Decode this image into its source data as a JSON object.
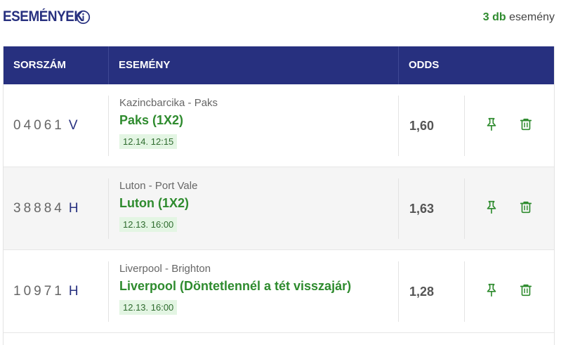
{
  "header": {
    "title": "ESEMÉNYEK",
    "count_number": "3 db",
    "count_label": "esemény"
  },
  "table": {
    "columns": [
      "SORSZÁM",
      "ESEMÉNY",
      "ODDS"
    ],
    "rows": [
      {
        "serial": "04061",
        "suffix": "V",
        "match": "Kazincbarcika - Paks",
        "pick": "Paks (1X2)",
        "datetime": "12.14. 12:15",
        "odds": "1,60"
      },
      {
        "serial": "38884",
        "suffix": "H",
        "match": "Luton - Port Vale",
        "pick": "Luton (1X2)",
        "datetime": "12.13. 16:00",
        "odds": "1,63"
      },
      {
        "serial": "10971",
        "suffix": "H",
        "match": "Liverpool - Brighton",
        "pick": "Liverpool (Döntetlennél a tét visszajár)",
        "datetime": "12.13. 16:00",
        "odds": "1,28"
      }
    ]
  },
  "colors": {
    "header_bg": "#27307f",
    "title": "#27307f",
    "accent_green": "#2e8b2e",
    "date_badge_bg": "#e3f5e3"
  },
  "icons": {
    "info": "info-circle-icon",
    "pin": "pin-icon",
    "delete": "trash-icon"
  }
}
